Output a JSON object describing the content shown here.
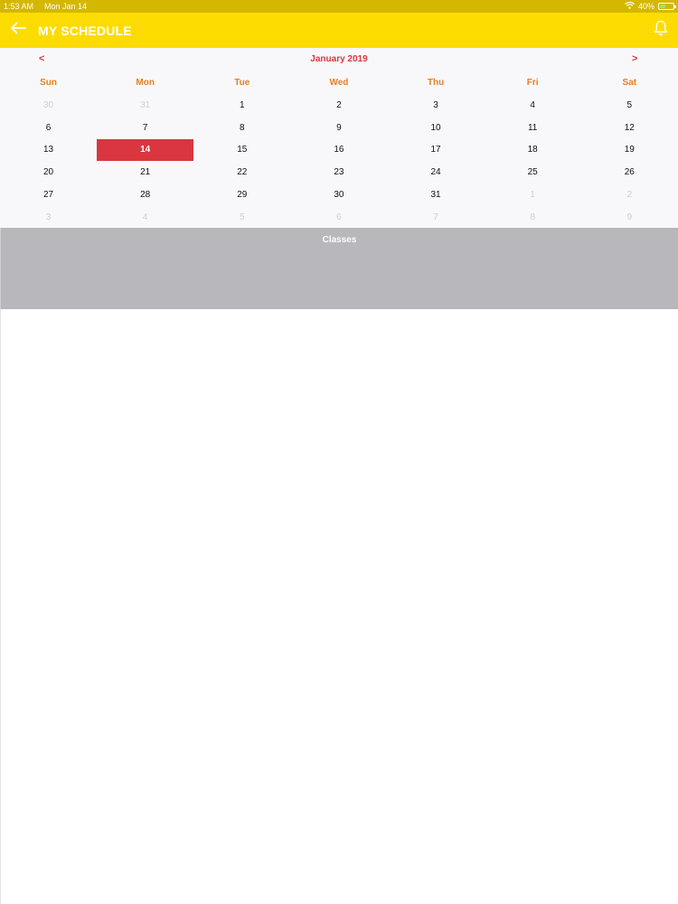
{
  "status_bar": {
    "time": "1:53 AM",
    "date": "Mon Jan 14",
    "battery_percent": "40%",
    "battery_level": 0.4,
    "wifi_icon": "wifi-icon"
  },
  "nav": {
    "title": "MY SCHEDULE",
    "back_icon": "arrow-left-icon",
    "bell_icon": "bell-icon"
  },
  "calendar": {
    "prev_label": "<",
    "next_label": ">",
    "month_title": "January 2019",
    "weekdays": [
      "Sun",
      "Mon",
      "Tue",
      "Wed",
      "Thu",
      "Fri",
      "Sat"
    ],
    "weeks": [
      [
        {
          "d": "30",
          "other": true
        },
        {
          "d": "31",
          "other": true
        },
        {
          "d": "1"
        },
        {
          "d": "2"
        },
        {
          "d": "3"
        },
        {
          "d": "4"
        },
        {
          "d": "5"
        }
      ],
      [
        {
          "d": "6"
        },
        {
          "d": "7"
        },
        {
          "d": "8"
        },
        {
          "d": "9"
        },
        {
          "d": "10"
        },
        {
          "d": "11"
        },
        {
          "d": "12"
        }
      ],
      [
        {
          "d": "13"
        },
        {
          "d": "14",
          "selected": true
        },
        {
          "d": "15"
        },
        {
          "d": "16"
        },
        {
          "d": "17"
        },
        {
          "d": "18"
        },
        {
          "d": "19"
        }
      ],
      [
        {
          "d": "20"
        },
        {
          "d": "21"
        },
        {
          "d": "22"
        },
        {
          "d": "23"
        },
        {
          "d": "24"
        },
        {
          "d": "25"
        },
        {
          "d": "26"
        }
      ],
      [
        {
          "d": "27"
        },
        {
          "d": "28"
        },
        {
          "d": "29"
        },
        {
          "d": "30"
        },
        {
          "d": "31"
        },
        {
          "d": "1",
          "other": true
        },
        {
          "d": "2",
          "other": true
        }
      ],
      [
        {
          "d": "3",
          "other": true
        },
        {
          "d": "4",
          "other": true
        },
        {
          "d": "5",
          "other": true
        },
        {
          "d": "6",
          "other": true
        },
        {
          "d": "7",
          "other": true
        },
        {
          "d": "8",
          "other": true
        },
        {
          "d": "9",
          "other": true
        }
      ]
    ]
  },
  "classes": {
    "title": "Classes"
  },
  "colors": {
    "nav_yellow": "#fcdc00",
    "status_yellow": "#d4b800",
    "accent_red": "#d9363f",
    "weekday_orange": "#e67f22",
    "panel_gray": "#b8b7bb"
  }
}
